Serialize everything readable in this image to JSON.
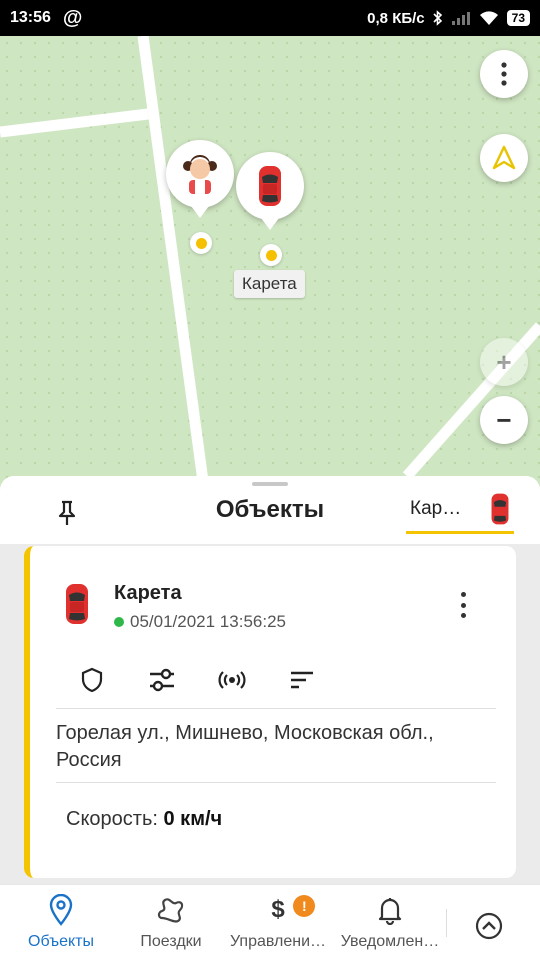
{
  "status_bar": {
    "time": "13:56",
    "notification_icon": "@",
    "net_speed": "0,8 КБ/с",
    "battery": "73"
  },
  "map": {
    "marker_label": "Карета",
    "menu_icon": "more-vertical-icon",
    "locate_icon": "navigation-arrow-icon",
    "zoom_in": "+",
    "zoom_out": "−"
  },
  "sheet": {
    "title": "Объекты",
    "selected_tab_label": "Кар…"
  },
  "object_card": {
    "name": "Карета",
    "timestamp": "05/01/2021 13:56:25",
    "status_color": "#2fb84a",
    "accent_color": "#f5c400",
    "address": "Горелая ул., Мишнево, Московская обл., Россия",
    "speed_label": "Скорость:",
    "speed_value": "0 км/ч"
  },
  "bottom_nav": {
    "items": [
      {
        "label": "Объекты",
        "icon": "map-pin-icon",
        "active": true
      },
      {
        "label": "Поездки",
        "icon": "route-icon",
        "active": false
      },
      {
        "label": "Управлени…",
        "icon": "dollar-icon",
        "active": false,
        "badge": "!"
      },
      {
        "label": "Уведомлен…",
        "icon": "bell-icon",
        "active": false
      }
    ]
  }
}
